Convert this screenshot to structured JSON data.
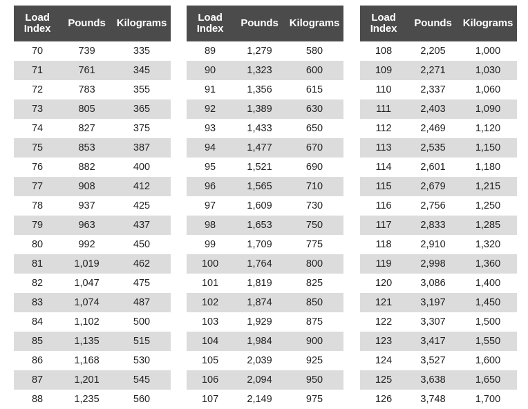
{
  "tables": [
    {
      "headers": {
        "index": "Load\nIndex",
        "index_line1": "Load",
        "index_line2": "Index",
        "pounds": "Pounds",
        "kilograms": "Kilograms"
      },
      "rows": [
        {
          "index": "70",
          "pounds": "739",
          "kilograms": "335"
        },
        {
          "index": "71",
          "pounds": "761",
          "kilograms": "345"
        },
        {
          "index": "72",
          "pounds": "783",
          "kilograms": "355"
        },
        {
          "index": "73",
          "pounds": "805",
          "kilograms": "365"
        },
        {
          "index": "74",
          "pounds": "827",
          "kilograms": "375"
        },
        {
          "index": "75",
          "pounds": "853",
          "kilograms": "387"
        },
        {
          "index": "76",
          "pounds": "882",
          "kilograms": "400"
        },
        {
          "index": "77",
          "pounds": "908",
          "kilograms": "412"
        },
        {
          "index": "78",
          "pounds": "937",
          "kilograms": "425"
        },
        {
          "index": "79",
          "pounds": "963",
          "kilograms": "437"
        },
        {
          "index": "80",
          "pounds": "992",
          "kilograms": "450"
        },
        {
          "index": "81",
          "pounds": "1,019",
          "kilograms": "462"
        },
        {
          "index": "82",
          "pounds": "1,047",
          "kilograms": "475"
        },
        {
          "index": "83",
          "pounds": "1,074",
          "kilograms": "487"
        },
        {
          "index": "84",
          "pounds": "1,102",
          "kilograms": "500"
        },
        {
          "index": "85",
          "pounds": "1,135",
          "kilograms": "515"
        },
        {
          "index": "86",
          "pounds": "1,168",
          "kilograms": "530"
        },
        {
          "index": "87",
          "pounds": "1,201",
          "kilograms": "545"
        },
        {
          "index": "88",
          "pounds": "1,235",
          "kilograms": "560"
        }
      ]
    },
    {
      "headers": {
        "index": "Load\nIndex",
        "index_line1": "Load",
        "index_line2": "Index",
        "pounds": "Pounds",
        "kilograms": "Kilograms"
      },
      "rows": [
        {
          "index": "89",
          "pounds": "1,279",
          "kilograms": "580"
        },
        {
          "index": "90",
          "pounds": "1,323",
          "kilograms": "600"
        },
        {
          "index": "91",
          "pounds": "1,356",
          "kilograms": "615"
        },
        {
          "index": "92",
          "pounds": "1,389",
          "kilograms": "630"
        },
        {
          "index": "93",
          "pounds": "1,433",
          "kilograms": "650"
        },
        {
          "index": "94",
          "pounds": "1,477",
          "kilograms": "670"
        },
        {
          "index": "95",
          "pounds": "1,521",
          "kilograms": "690"
        },
        {
          "index": "96",
          "pounds": "1,565",
          "kilograms": "710"
        },
        {
          "index": "97",
          "pounds": "1,609",
          "kilograms": "730"
        },
        {
          "index": "98",
          "pounds": "1,653",
          "kilograms": "750"
        },
        {
          "index": "99",
          "pounds": "1,709",
          "kilograms": "775"
        },
        {
          "index": "100",
          "pounds": "1,764",
          "kilograms": "800"
        },
        {
          "index": "101",
          "pounds": "1,819",
          "kilograms": "825"
        },
        {
          "index": "102",
          "pounds": "1,874",
          "kilograms": "850"
        },
        {
          "index": "103",
          "pounds": "1,929",
          "kilograms": "875"
        },
        {
          "index": "104",
          "pounds": "1,984",
          "kilograms": "900"
        },
        {
          "index": "105",
          "pounds": "2,039",
          "kilograms": "925"
        },
        {
          "index": "106",
          "pounds": "2,094",
          "kilograms": "950"
        },
        {
          "index": "107",
          "pounds": "2,149",
          "kilograms": "975"
        }
      ]
    },
    {
      "headers": {
        "index": "Load\nIndex",
        "index_line1": "Load",
        "index_line2": "Index",
        "pounds": "Pounds",
        "kilograms": "Kilograms"
      },
      "rows": [
        {
          "index": "108",
          "pounds": "2,205",
          "kilograms": "1,000"
        },
        {
          "index": "109",
          "pounds": "2,271",
          "kilograms": "1,030"
        },
        {
          "index": "110",
          "pounds": "2,337",
          "kilograms": "1,060"
        },
        {
          "index": "111",
          "pounds": "2,403",
          "kilograms": "1,090"
        },
        {
          "index": "112",
          "pounds": "2,469",
          "kilograms": "1,120"
        },
        {
          "index": "113",
          "pounds": "2,535",
          "kilograms": "1,150"
        },
        {
          "index": "114",
          "pounds": "2,601",
          "kilograms": "1,180"
        },
        {
          "index": "115",
          "pounds": "2,679",
          "kilograms": "1,215"
        },
        {
          "index": "116",
          "pounds": "2,756",
          "kilograms": "1,250"
        },
        {
          "index": "117",
          "pounds": "2,833",
          "kilograms": "1,285"
        },
        {
          "index": "118",
          "pounds": "2,910",
          "kilograms": "1,320"
        },
        {
          "index": "119",
          "pounds": "2,998",
          "kilograms": "1,360"
        },
        {
          "index": "120",
          "pounds": "3,086",
          "kilograms": "1,400"
        },
        {
          "index": "121",
          "pounds": "3,197",
          "kilograms": "1,450"
        },
        {
          "index": "122",
          "pounds": "3,307",
          "kilograms": "1,500"
        },
        {
          "index": "123",
          "pounds": "3,417",
          "kilograms": "1,550"
        },
        {
          "index": "124",
          "pounds": "3,527",
          "kilograms": "1,600"
        },
        {
          "index": "125",
          "pounds": "3,638",
          "kilograms": "1,650"
        },
        {
          "index": "126",
          "pounds": "3,748",
          "kilograms": "1,700"
        }
      ]
    }
  ],
  "colors": {
    "header_bg": "#4b4b4b",
    "header_text": "#ffffff",
    "row_stripe": "#dcdcdc",
    "row_plain": "#ffffff",
    "body_text": "#222222",
    "page_bg": "#ffffff"
  }
}
